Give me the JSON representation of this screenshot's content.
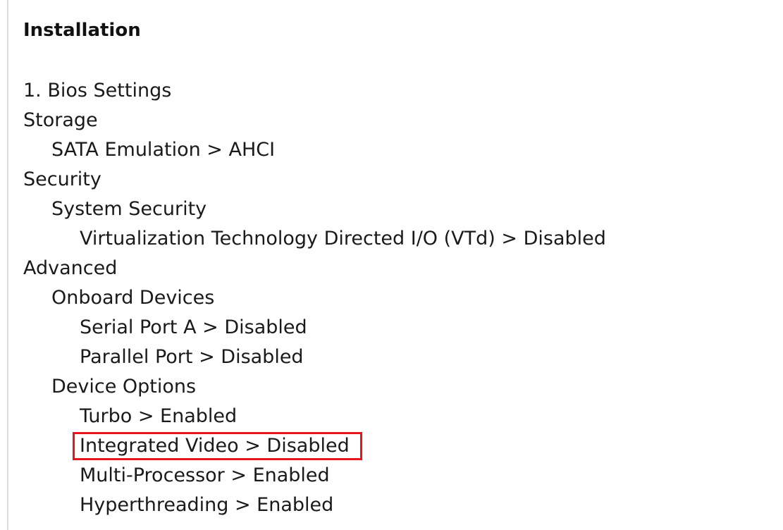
{
  "doc": {
    "title": "Installation",
    "items": [
      {
        "text": "1. Bios Settings",
        "level": 0
      },
      {
        "text": "Storage",
        "level": 0
      },
      {
        "text": "SATA Emulation > AHCI",
        "level": 1
      },
      {
        "text": "Security",
        "level": 0
      },
      {
        "text": "System Security",
        "level": 1
      },
      {
        "text": "Virtualization Technology Directed I/O (VTd) > Disabled",
        "level": 2
      },
      {
        "text": "Advanced",
        "level": 0
      },
      {
        "text": "Onboard Devices",
        "level": 1
      },
      {
        "text": "Serial Port A > Disabled",
        "level": 2
      },
      {
        "text": "Parallel Port > Disabled",
        "level": 2
      },
      {
        "text": "Device Options",
        "level": 1
      },
      {
        "text": "Turbo > Enabled",
        "level": 2
      },
      {
        "text": "Integrated Video > Disabled",
        "level": 2,
        "highlighted": true
      },
      {
        "text": "Multi-Processor > Enabled",
        "level": 2
      },
      {
        "text": "Hyperthreading > Enabled",
        "level": 2
      }
    ]
  },
  "colors": {
    "text": "#1a1a1a",
    "highlight_border": "#e8141b",
    "left_border": "#dcdcdc"
  }
}
